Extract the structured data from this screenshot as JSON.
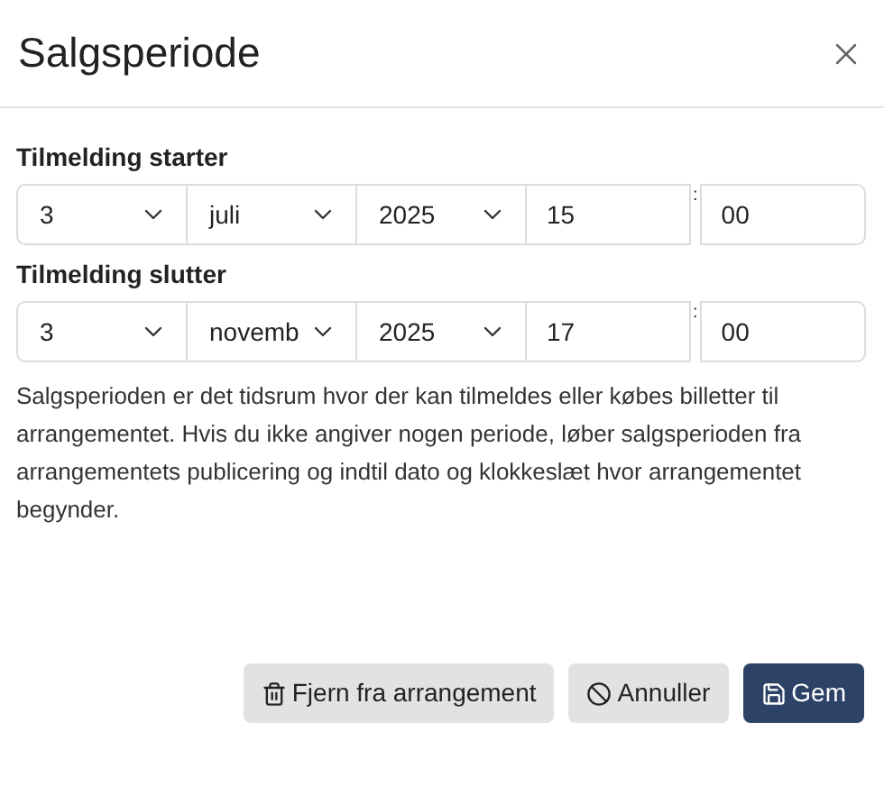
{
  "dialog": {
    "title": "Salgsperiode"
  },
  "ranges": [
    {
      "label": "Tilmelding starter",
      "day": "3",
      "month": "juli",
      "year": "2025",
      "hour": "15",
      "separator": ":",
      "minute": "00"
    },
    {
      "label": "Tilmelding slutter",
      "day": "3",
      "month": "novemb",
      "year": "2025",
      "hour": "17",
      "separator": ":",
      "minute": "00"
    }
  ],
  "help_text": "Salgsperioden er det tidsrum hvor der kan tilmeldes eller købes billetter til arrangementet. Hvis du ikke angiver nogen periode, løber salgsperioden fra arrangementets publicering og indtil dato og klokkeslæt hvor arrangementet begynder.",
  "buttons": [
    {
      "kind": "remove",
      "label": "Fjern fra arrangement"
    },
    {
      "kind": "cancel",
      "label": "Annuller"
    },
    {
      "kind": "save",
      "label": "Gem"
    }
  ]
}
